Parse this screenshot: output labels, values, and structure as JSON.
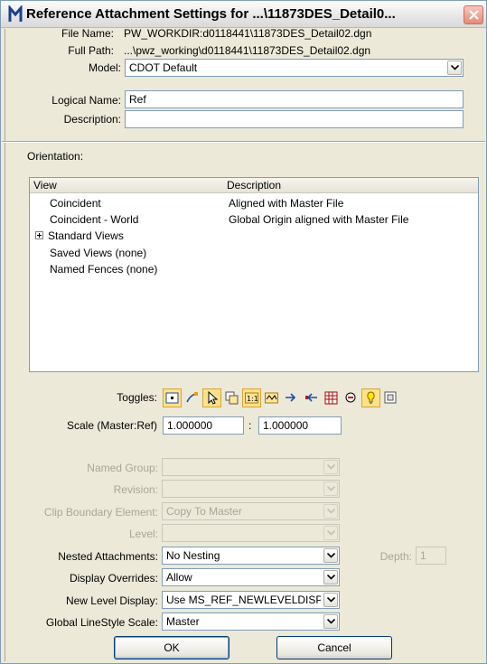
{
  "window": {
    "title": "Reference Attachment Settings for ...\\11873DES_Detail0..."
  },
  "file": {
    "file_name_label": "File Name:",
    "file_name_value": "PW_WORKDIR:d0118441\\11873DES_Detail02.dgn",
    "full_path_label": "Full Path:",
    "full_path_value": "...\\pwz_working\\d0118441\\11873DES_Detail02.dgn",
    "model_label": "Model:",
    "model_value": "CDOT Default",
    "logical_name_label": "Logical Name:",
    "logical_name_value": "Ref",
    "description_label": "Description:",
    "description_value": ""
  },
  "orientation": {
    "label": "Orientation:",
    "columns": [
      "View",
      "Description"
    ],
    "rows": [
      {
        "view": "Coincident",
        "description": "Aligned with Master File",
        "expandable": false
      },
      {
        "view": "Coincident - World",
        "description": "Global Origin aligned with Master File",
        "expandable": false
      },
      {
        "view": "Standard Views",
        "description": "",
        "expandable": true
      },
      {
        "view": "Saved Views (none)",
        "description": "",
        "expandable": false
      },
      {
        "view": "Named Fences (none)",
        "description": "",
        "expandable": false
      }
    ]
  },
  "toggles": {
    "label": "Toggles:",
    "icons": [
      "display-toggle-icon",
      "snap-toggle-icon",
      "locate-toggle-icon",
      "ignore-toggle-icon",
      "true-scale-toggle-icon",
      "scale-line-style-icon",
      "georeference-icon",
      "treat-as-element-icon",
      "raster-toggle-icon",
      "level-display-icon",
      "lighting-toggle-icon",
      "clip-toggle-icon"
    ]
  },
  "scale": {
    "label": "Scale (Master:Ref)",
    "master_value": "1.000000",
    "separator": ":",
    "ref_value": "1.000000"
  },
  "options": {
    "named_group_label": "Named Group:",
    "named_group_value": "",
    "revision_label": "Revision:",
    "revision_value": "",
    "clip_boundary_label": "Clip Boundary Element:",
    "clip_boundary_value": "Copy To Master",
    "level_label": "Level:",
    "level_value": "",
    "nested_label": "Nested Attachments:",
    "nested_value": "No Nesting",
    "depth_label": "Depth:",
    "depth_value": "1",
    "display_overrides_label": "Display Overrides:",
    "display_overrides_value": "Allow",
    "new_level_display_label": "New Level Display:",
    "new_level_display_value": "Use MS_REF_NEWLEVELDISPLAY",
    "global_linestyle_label": "Global LineStyle Scale:",
    "global_linestyle_value": "Master"
  },
  "buttons": {
    "ok": "OK",
    "cancel": "Cancel"
  },
  "colors": {
    "dialog_bg": "#ece9d8",
    "toggle_on": "#fde28a",
    "disabled_text": "#a7a69a"
  }
}
